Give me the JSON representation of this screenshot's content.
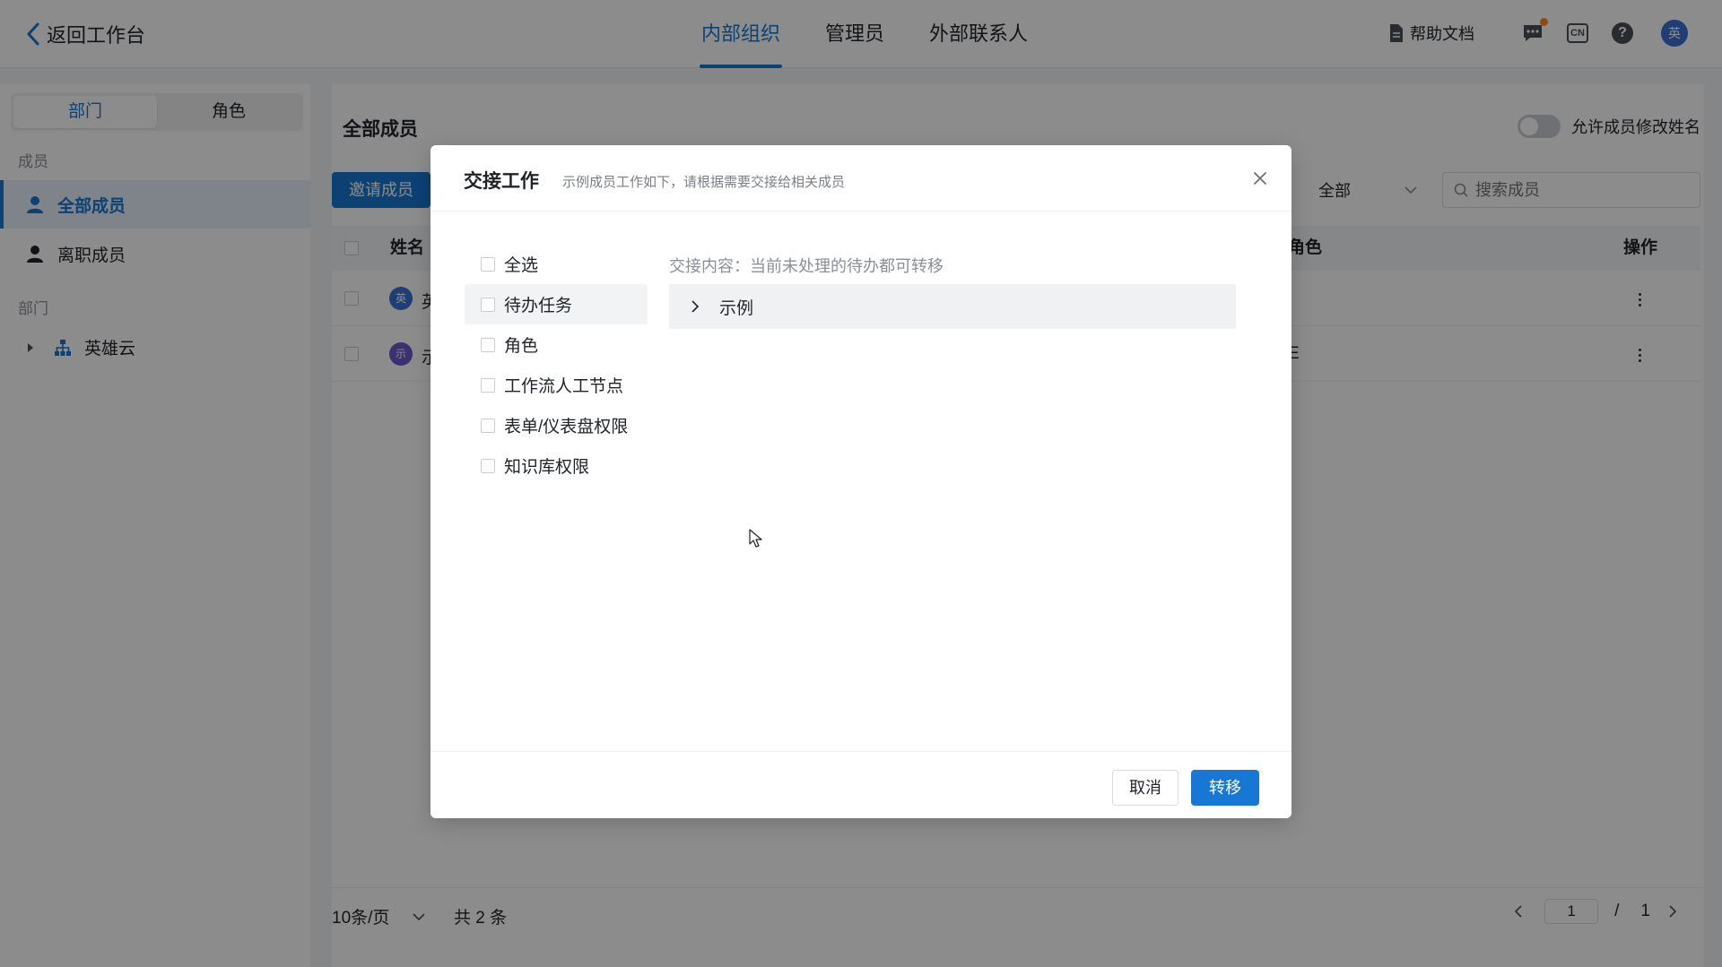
{
  "topbar": {
    "back_label": "返回工作台",
    "tabs": [
      {
        "label": "内部组织",
        "active": true
      },
      {
        "label": "管理员",
        "active": false
      },
      {
        "label": "外部联系人",
        "active": false
      }
    ],
    "help_doc_label": "帮助文档",
    "lang_badge": "CN",
    "help_symbol": "?",
    "user_avatar": "英",
    "accent_color": "#1677d4"
  },
  "sidebar": {
    "segments": [
      {
        "label": "部门",
        "active": true
      },
      {
        "label": "角色",
        "active": false
      }
    ],
    "members_label": "成员",
    "items": [
      {
        "label": "全部成员",
        "active": true
      },
      {
        "label": "离职成员",
        "active": false
      }
    ],
    "dept_label": "部门",
    "tree": [
      {
        "label": "英雄云",
        "collapsed": true
      }
    ]
  },
  "main": {
    "title": "全部成员",
    "toggle_label": "允许成员修改姓名",
    "toggle_on": false,
    "invite_label": "邀请成员",
    "filter_value": "全部",
    "search_placeholder": "搜索成员",
    "columns": {
      "name": "姓名",
      "role": "角色",
      "action": "操作"
    },
    "rows": [
      {
        "avatar": "英",
        "name": "英",
        "role": ""
      },
      {
        "avatar": "示",
        "name": "示",
        "role": "E"
      }
    ],
    "pagination": {
      "page_size": "10条/页",
      "total": "共 2 条",
      "current_page": "1",
      "separator": "/",
      "total_pages": "1"
    }
  },
  "modal": {
    "title": "交接工作",
    "subtitle": "示例成员工作如下，请根据需要交接给相关成员",
    "options": [
      {
        "label": "全选",
        "checked": false
      },
      {
        "label": "待办任务",
        "checked": false
      },
      {
        "label": "角色",
        "checked": false
      },
      {
        "label": "工作流人工节点",
        "checked": false
      },
      {
        "label": "表单/仪表盘权限",
        "checked": false
      },
      {
        "label": "知识库权限",
        "checked": false
      }
    ],
    "content_desc": "交接内容：当前未处理的待办都可转移",
    "collapse_label": "示例",
    "cancel_label": "取消",
    "confirm_label": "转移"
  }
}
